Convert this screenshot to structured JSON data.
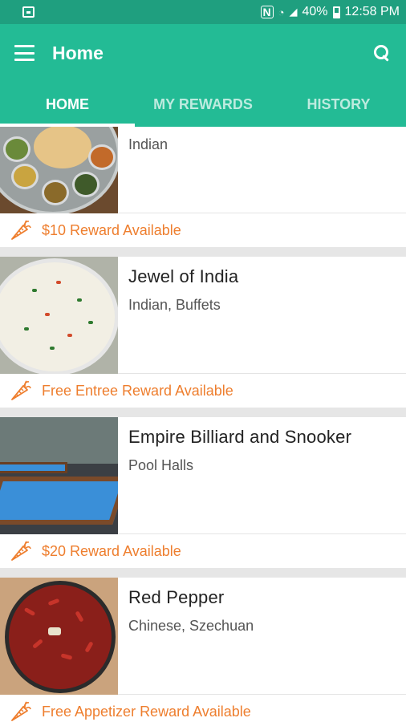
{
  "status_bar": {
    "battery": "40%",
    "time": "12:58 PM"
  },
  "app_bar": {
    "title": "Home"
  },
  "tabs": [
    {
      "label": "HOME",
      "active": true
    },
    {
      "label": "MY REWARDS",
      "active": false
    },
    {
      "label": "HISTORY",
      "active": false
    }
  ],
  "cards": [
    {
      "name": "",
      "categories": "Indian",
      "reward": "$10 Reward Available",
      "image": "indian-thali-photo"
    },
    {
      "name": "Jewel of India",
      "categories": "Indian, Buffets",
      "reward": "Free Entree Reward Available",
      "image": "rice-dish-photo"
    },
    {
      "name": "Empire Billiard and Snooker",
      "categories": "Pool Halls",
      "reward": "$20 Reward Available",
      "image": "pool-hall-photo"
    },
    {
      "name": "Red Pepper",
      "categories": "Chinese, Szechuan",
      "reward": "Free Appetizer Reward Available",
      "image": "szechuan-dish-photo"
    }
  ],
  "colors": {
    "status_bar": "#1f9f7f",
    "app_bar": "#23bb95",
    "reward_accent": "#ee7e2e"
  },
  "icons": {
    "menu": "menu-icon",
    "search": "search-icon",
    "reward": "carrot-icon"
  }
}
